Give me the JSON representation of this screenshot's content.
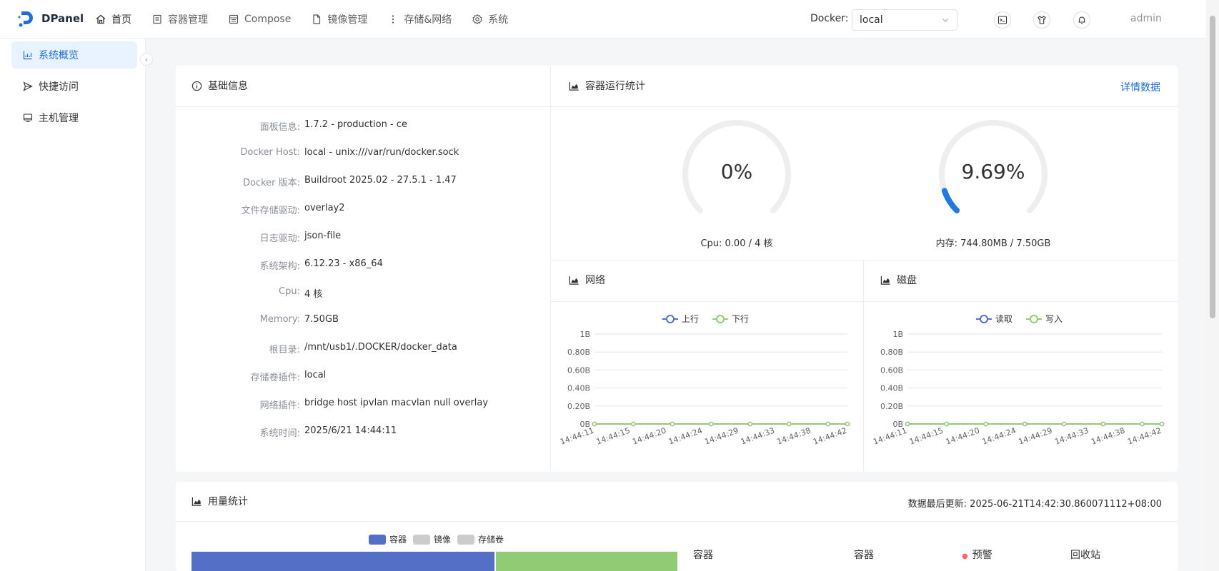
{
  "app": {
    "name": "DPanel"
  },
  "nav": [
    {
      "label": "首页",
      "icon": "home-icon"
    },
    {
      "label": "容器管理",
      "icon": "container-icon"
    },
    {
      "label": "Compose",
      "icon": "compose-icon"
    },
    {
      "label": "镜像管理",
      "icon": "file-icon"
    },
    {
      "label": "存储&网络",
      "icon": "more-vertical-icon"
    },
    {
      "label": "系统",
      "icon": "gear-icon"
    }
  ],
  "docker": {
    "label": "Docker:",
    "selected": "local"
  },
  "user": {
    "name": "admin"
  },
  "sidebar": [
    {
      "label": "系统概览",
      "icon": "chart-icon",
      "active": true
    },
    {
      "label": "快捷访问",
      "icon": "send-icon",
      "active": false
    },
    {
      "label": "主机管理",
      "icon": "monitor-icon",
      "active": false
    }
  ],
  "basic_info": {
    "title": "基础信息",
    "rows": [
      {
        "key": "面板信息:",
        "value": "1.7.2  -  production  -  ce"
      },
      {
        "key": "Docker Host:",
        "value": "local - unix:///var/run/docker.sock"
      },
      {
        "key": "Docker 版本:",
        "value": "Buildroot 2025.02 - 27.5.1 - 1.47"
      },
      {
        "key": "文件存储驱动:",
        "value": "overlay2"
      },
      {
        "key": "日志驱动:",
        "value": "json-file"
      },
      {
        "key": "系统架构:",
        "value": "6.12.23 - x86_64"
      },
      {
        "key": "Cpu:",
        "value": "4 核"
      },
      {
        "key": "Memory:",
        "value": "7.50GB"
      },
      {
        "key": "根目录:",
        "value": "/mnt/usb1/.DOCKER/docker_data"
      },
      {
        "key": "存储卷插件:",
        "value": "local"
      },
      {
        "key": "网络插件:",
        "value": "bridge  host  ipvlan  macvlan  null  overlay"
      },
      {
        "key": "系统时间:",
        "value": "2025/6/21 14:44:11"
      }
    ]
  },
  "container_stats": {
    "title": "容器运行统计",
    "detail_link": "详情数据",
    "cpu": {
      "value": "0%",
      "percent": 0,
      "label": "Cpu: 0.00 / 4 核"
    },
    "memory": {
      "value": "9.69%",
      "percent": 9.69,
      "label": "内存: 744.80MB / 7.50GB"
    },
    "colors": {
      "track": "#eeeeee",
      "fill": "#1f7ae0"
    }
  },
  "network": {
    "title": "网络",
    "legend": [
      "上行",
      "下行"
    ],
    "colors": [
      "#5470c6",
      "#91cc75"
    ],
    "chart_data": {
      "type": "line",
      "x": [
        "14:44:11",
        "14:44:15",
        "14:44:20",
        "14:44:24",
        "14:44:29",
        "14:44:33",
        "14:44:38",
        "14:44:42"
      ],
      "y_ticks": [
        "1B",
        "0.80B",
        "0.60B",
        "0.40B",
        "0.20B",
        "0B"
      ],
      "ylim": [
        0,
        1
      ],
      "series": [
        {
          "name": "上行",
          "values": [
            0,
            0,
            0,
            0,
            0,
            0,
            0,
            0,
            0,
            0,
            0,
            0,
            0,
            0
          ]
        },
        {
          "name": "下行",
          "values": [
            0,
            0,
            0,
            0,
            0,
            0,
            0,
            0,
            0,
            0,
            0,
            0,
            0,
            0
          ]
        }
      ]
    }
  },
  "disk": {
    "title": "磁盘",
    "legend": [
      "读取",
      "写入"
    ],
    "colors": [
      "#5470c6",
      "#91cc75"
    ],
    "chart_data": {
      "type": "line",
      "x": [
        "14:44:11",
        "14:44:15",
        "14:44:20",
        "14:44:24",
        "14:44:29",
        "14:44:33",
        "14:44:38",
        "14:44:42"
      ],
      "y_ticks": [
        "1B",
        "0.80B",
        "0.60B",
        "0.40B",
        "0.20B",
        "0B"
      ],
      "ylim": [
        0,
        1
      ],
      "series": [
        {
          "name": "读取",
          "values": [
            0,
            0,
            0,
            0,
            0,
            0,
            0,
            0,
            0,
            0,
            0,
            0,
            0,
            0
          ]
        },
        {
          "name": "写入",
          "values": [
            0,
            0,
            0,
            0,
            0,
            0,
            0,
            0,
            0,
            0,
            0,
            0,
            0,
            0
          ]
        }
      ]
    }
  },
  "usage": {
    "title": "用量统计",
    "updated": "数据最后更新: 2025-06-21T14:42:30.860071112+08:00",
    "legend": [
      {
        "label": "容器",
        "color": "#5470c6",
        "active": true
      },
      {
        "label": "镜像",
        "color": "#cccccc",
        "active": false
      },
      {
        "label": "存储卷",
        "color": "#cccccc",
        "active": false
      }
    ],
    "bar_colors": [
      "#5470c6",
      "#91cc75"
    ],
    "columns": [
      "容器",
      "容器",
      "预警",
      "回收站"
    ],
    "warn_color": "#f56c6c"
  }
}
